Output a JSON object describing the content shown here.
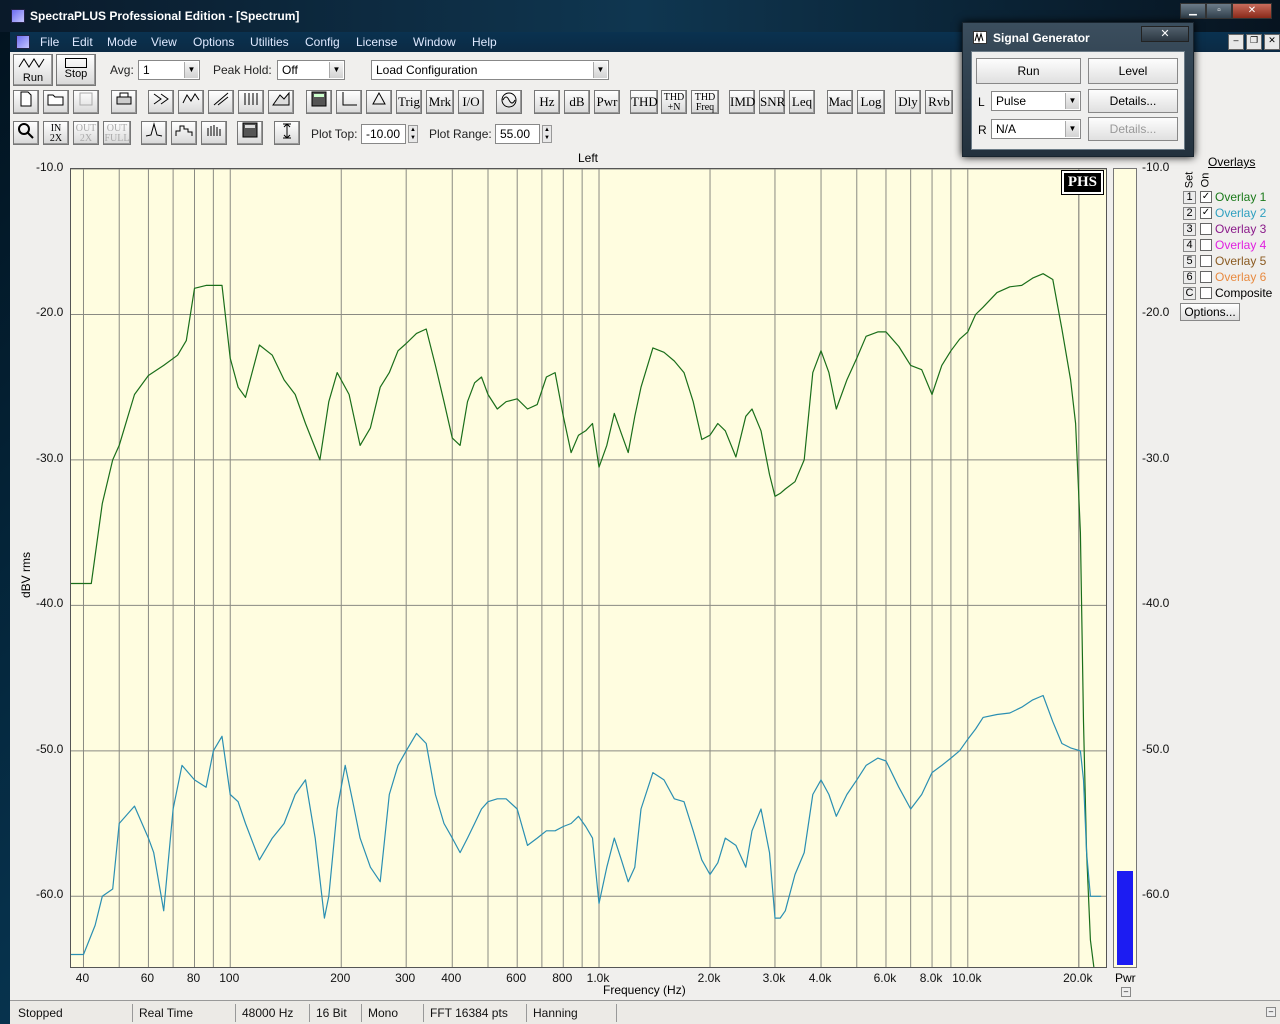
{
  "window": {
    "title": "SpectraPLUS Professional Edition - [Spectrum]"
  },
  "menu": [
    "File",
    "Edit",
    "Mode",
    "View",
    "Options",
    "Utilities",
    "Config",
    "License",
    "Window",
    "Help"
  ],
  "toolbar1": {
    "run_label": "Run",
    "stop_label": "Stop",
    "avg_label": "Avg:",
    "avg_value": "1",
    "peak_hold_label": "Peak Hold:",
    "peak_hold_value": "Off",
    "config_value": "Load Configuration"
  },
  "toolbar2": {
    "buttons": [
      "Trig",
      "Mrk",
      "I/O",
      "Hz",
      "dB",
      "Pwr",
      "THD",
      "THD +N",
      "THD Freq",
      "IMD",
      "SNR",
      "Leq",
      "Mac",
      "Log",
      "Dly",
      "Rvb"
    ]
  },
  "toolbar3": {
    "buttons": [
      "IN 2X",
      "OUT 2X",
      "OUT FULL"
    ],
    "plot_top_label": "Plot Top:",
    "plot_top_value": "-10.00",
    "plot_range_label": "Plot Range:",
    "plot_range_value": "55.00"
  },
  "plot": {
    "channel": "Left",
    "ylabel": "dBV rms",
    "xlabel": "Frequency (Hz)",
    "logo": "PHS",
    "meter_label": "Pwr",
    "meter_level_db": -58.5
  },
  "chart_data": {
    "type": "line",
    "xlabel": "Frequency (Hz)",
    "ylabel": "dBV rms",
    "title": "Left",
    "x_scale": "log",
    "xlim": [
      37,
      24000
    ],
    "ylim": [
      -65,
      -10
    ],
    "grid": true,
    "x_ticks": [
      40,
      60,
      80,
      100,
      200,
      300,
      400,
      600,
      800,
      1000,
      2000,
      3000,
      4000,
      6000,
      8000,
      10000,
      20000
    ],
    "x_tick_labels": [
      "40",
      "60",
      "80",
      "100",
      "200",
      "300",
      "400",
      "600",
      "800",
      "1.0k",
      "2.0k",
      "3.0k",
      "4.0k",
      "6.0k",
      "8.0k",
      "10.0k",
      "20.0k"
    ],
    "y_ticks": [
      -10,
      -20,
      -30,
      -40,
      -50,
      -60
    ],
    "y_tick_labels": [
      "-10.0",
      "-20.0",
      "-30.0",
      "-40.0",
      "-50.0",
      "-60.0"
    ],
    "series": [
      {
        "name": "Overlay 1",
        "color": "#1a6e1a",
        "x": [
          37,
          42,
          45,
          48,
          50,
          55,
          60,
          66,
          72,
          76,
          80,
          86,
          90,
          95,
          100,
          105,
          110,
          120,
          130,
          140,
          150,
          160,
          175,
          185,
          195,
          210,
          225,
          240,
          255,
          270,
          285,
          300,
          320,
          340,
          360,
          380,
          400,
          420,
          440,
          460,
          480,
          500,
          530,
          560,
          600,
          640,
          680,
          720,
          760,
          800,
          840,
          880,
          920,
          960,
          1000,
          1050,
          1100,
          1150,
          1200,
          1250,
          1300,
          1400,
          1500,
          1600,
          1700,
          1800,
          1900,
          2000,
          2100,
          2200,
          2350,
          2500,
          2600,
          2750,
          2900,
          3000,
          3100,
          3200,
          3400,
          3600,
          3800,
          4000,
          4200,
          4400,
          4700,
          5000,
          5300,
          5700,
          6000,
          6500,
          7000,
          7500,
          8000,
          8500,
          9000,
          9500,
          10000,
          10500,
          11000,
          12000,
          13000,
          14000,
          15000,
          16000,
          17000,
          18000,
          19000,
          19600,
          20200,
          20600,
          21000,
          21500,
          22000,
          23000
        ],
        "y": [
          -38.5,
          -38.5,
          -33,
          -30,
          -29,
          -25.5,
          -24.2,
          -23.5,
          -22.8,
          -21.8,
          -18.2,
          -18,
          -18,
          -18,
          -23,
          -25,
          -25.7,
          -22.1,
          -22.8,
          -24.5,
          -25.5,
          -27.5,
          -30,
          -26,
          -24,
          -25.5,
          -29,
          -27.8,
          -25,
          -24,
          -22.5,
          -22,
          -21.3,
          -21,
          -23.5,
          -26,
          -28.5,
          -29,
          -26,
          -24.7,
          -24.3,
          -25.5,
          -26.5,
          -26,
          -25.8,
          -26.5,
          -26.2,
          -24.3,
          -24,
          -27,
          -29.5,
          -28.3,
          -28,
          -27.5,
          -30.5,
          -29,
          -26.8,
          -28.2,
          -29.5,
          -27,
          -25,
          -22.3,
          -22.6,
          -23.2,
          -24,
          -26,
          -28.6,
          -28.3,
          -27.5,
          -28,
          -29.8,
          -27,
          -26.5,
          -28,
          -31,
          -32.5,
          -32.3,
          -32,
          -31.5,
          -30,
          -24,
          -22.5,
          -24,
          -26.5,
          -24.5,
          -23,
          -21.5,
          -21.2,
          -21.2,
          -22.2,
          -23.5,
          -23.8,
          -25.5,
          -23.5,
          -22.5,
          -21.7,
          -21.2,
          -20,
          -19.5,
          -18.5,
          -18.1,
          -18,
          -17.5,
          -17.2,
          -17.6,
          -21,
          -24.5,
          -27.5,
          -35,
          -48,
          -57,
          -63,
          -65,
          -65
        ]
      },
      {
        "name": "Overlay 2",
        "color": "#2a8fb2",
        "x": [
          37,
          40,
          43,
          45,
          48,
          50,
          55,
          60,
          62,
          66,
          70,
          74,
          80,
          86,
          90,
          95,
          100,
          105,
          110,
          120,
          130,
          140,
          150,
          160,
          170,
          180,
          185,
          195,
          205,
          215,
          225,
          240,
          255,
          270,
          285,
          300,
          320,
          340,
          360,
          380,
          400,
          420,
          440,
          460,
          480,
          500,
          530,
          560,
          600,
          640,
          680,
          720,
          760,
          800,
          840,
          880,
          920,
          960,
          1000,
          1050,
          1100,
          1150,
          1200,
          1250,
          1300,
          1400,
          1500,
          1600,
          1700,
          1800,
          1900,
          2000,
          2100,
          2200,
          2350,
          2500,
          2600,
          2750,
          2900,
          3000,
          3100,
          3200,
          3400,
          3600,
          3800,
          4000,
          4200,
          4400,
          4700,
          5000,
          5300,
          5700,
          6000,
          6500,
          7000,
          7500,
          8000,
          8500,
          9000,
          9500,
          10000,
          10500,
          11000,
          12000,
          13000,
          14000,
          15000,
          16000,
          17000,
          18000,
          19000,
          19600,
          20200,
          20600,
          21000,
          21500,
          22000,
          23000
        ],
        "y": [
          -64,
          -64,
          -62,
          -60,
          -59.5,
          -55,
          -53.8,
          -56,
          -57,
          -61,
          -54,
          -51,
          -52,
          -52.5,
          -50,
          -49,
          -53,
          -53.5,
          -55,
          -57.5,
          -56,
          -55,
          -53,
          -52,
          -56,
          -61.5,
          -60,
          -54,
          -51,
          -53.5,
          -56,
          -58,
          -59,
          -53,
          -51,
          -50,
          -48.8,
          -49.5,
          -53,
          -55,
          -56,
          -57,
          -56,
          -55,
          -54,
          -53.5,
          -53.3,
          -53.3,
          -54,
          -56.5,
          -56,
          -55.5,
          -55.5,
          -55.2,
          -55,
          -54.5,
          -55.2,
          -56,
          -60.5,
          -58,
          -56,
          -57.5,
          -59,
          -58,
          -54,
          -51.5,
          -52,
          -53.3,
          -53.5,
          -55.5,
          -57.5,
          -58.5,
          -57.7,
          -56,
          -56.5,
          -58,
          -55.5,
          -54,
          -57,
          -61.5,
          -61.5,
          -61,
          -58.5,
          -57,
          -53,
          -52,
          -53,
          -54.5,
          -53,
          -52,
          -51,
          -50.5,
          -50.7,
          -52.5,
          -54,
          -53,
          -51.5,
          -51,
          -50.5,
          -50,
          -49.2,
          -48.5,
          -47.7,
          -47.5,
          -47.4,
          -47,
          -46.5,
          -46.2,
          -48,
          -49.5,
          -49.8,
          -49.9,
          -50,
          -52,
          -57,
          -60,
          -60,
          -60
        ]
      }
    ]
  },
  "overlays": {
    "title": "Overlays",
    "col_set": "Set",
    "col_on": "On",
    "items": [
      {
        "num": "1",
        "label": "Overlay 1",
        "checked": "✓",
        "color": "#1a7a1a"
      },
      {
        "num": "2",
        "label": "Overlay 2",
        "checked": "✓",
        "color": "#2fa0c0"
      },
      {
        "num": "3",
        "label": "Overlay 3",
        "checked": "",
        "color": "#8a1a8a"
      },
      {
        "num": "4",
        "label": "Overlay 4",
        "checked": "",
        "color": "#e020e0"
      },
      {
        "num": "5",
        "label": "Overlay 5",
        "checked": "",
        "color": "#8a5a20"
      },
      {
        "num": "6",
        "label": "Overlay 6",
        "checked": "",
        "color": "#e88a40"
      },
      {
        "num": "C",
        "label": "Composite",
        "checked": "",
        "color": "#000000"
      }
    ],
    "options_label": "Options..."
  },
  "status": [
    "Stopped",
    "Real Time",
    "48000 Hz",
    "16 Bit",
    "Mono",
    "FFT 16384 pts",
    "Hanning"
  ],
  "signal_generator": {
    "title": "Signal Generator",
    "run_label": "Run",
    "level_label": "Level",
    "left_channel": "L",
    "left_value": "Pulse",
    "left_details": "Details...",
    "right_channel": "R",
    "right_value": "N/A",
    "right_details": "Details..."
  }
}
